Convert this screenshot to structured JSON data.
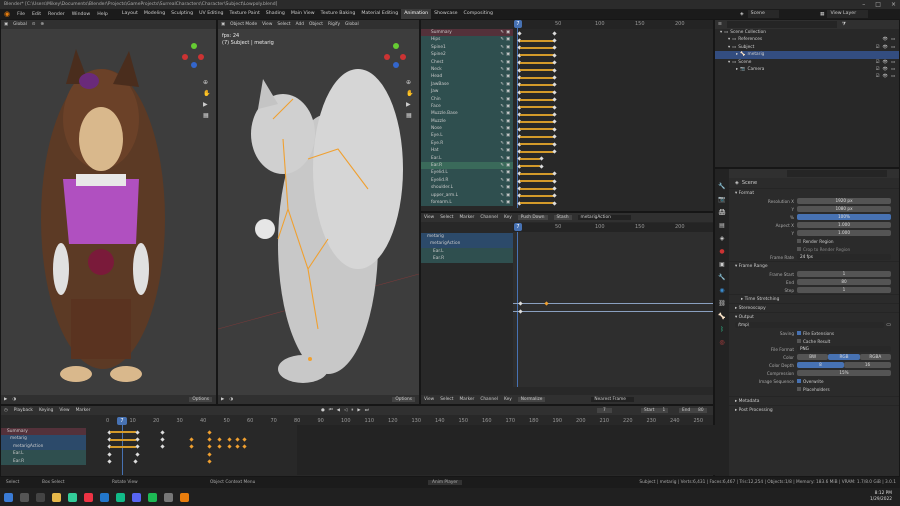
{
  "title": "Blender* [C:\\Users\\Mikey\\Documents\\Blender\\Projects\\GameProjects\\SurrealCharacters\\Character\\Subject\\Lowpoly.blend]",
  "menu": [
    "File",
    "Edit",
    "Render",
    "Window",
    "Help"
  ],
  "workspaces": [
    "Layout",
    "Modeling",
    "Sculpting",
    "UV Editing",
    "Texture Paint",
    "Shading",
    "Main View",
    "Texture Baking",
    "Material Editing",
    "Animation",
    "Showcase",
    "Compositing"
  ],
  "active_workspace": "Animation",
  "scene": "Scene",
  "view_layer": "View Layer",
  "vp1": {
    "orient": "Global",
    "options": "Options"
  },
  "vp2": {
    "mode": "Object Mode",
    "menus": [
      "View",
      "Select",
      "Add",
      "Object",
      "Rigify"
    ],
    "orient": "Global",
    "fps": "fps: 24",
    "subject": "(7) Subject | metarig",
    "options": "Options"
  },
  "dopesheet": {
    "ticks": [
      "0",
      "50",
      "100",
      "150",
      "200",
      "250"
    ],
    "current": "7",
    "channels": [
      "Summary",
      "Hips",
      "Spine1",
      "Spine2",
      "Chest",
      "Neck",
      "Head",
      "JawBase",
      "Jaw",
      "Chin",
      "Face",
      "Muzzle.Base",
      "Muzzle",
      "Nose",
      "Eye.L",
      "Eye.R",
      "Hat",
      "Ear.L",
      "Ear.R",
      "Eyelid.L",
      "Eyelid.R",
      "shoulder.L",
      "upper_arm.L",
      "forearm.L"
    ],
    "menus": [
      "View",
      "Select",
      "Marker",
      "Channel",
      "Key"
    ],
    "push": "Push Down",
    "stash": "Stash",
    "action": "metarigAction"
  },
  "graph": {
    "channels": [
      "metarig",
      "metarigAction",
      "Ear.L",
      "Ear.R"
    ],
    "ticks": [
      "0",
      "50",
      "100",
      "150",
      "200"
    ],
    "current": "7",
    "menus": [
      "View",
      "Select",
      "Marker",
      "Channel",
      "Key"
    ],
    "normalize": "Normalize",
    "frame_mode": "Nearest Frame"
  },
  "timeline": {
    "menus": [
      "Playback",
      "Keying",
      "View",
      "Marker"
    ],
    "current": "7",
    "start_label": "Start",
    "start": "1",
    "end_label": "End",
    "end": "80",
    "ticks": [
      "0",
      "10",
      "20",
      "30",
      "40",
      "50",
      "60",
      "70",
      "80",
      "90",
      "100",
      "110",
      "120",
      "130",
      "140",
      "150",
      "160",
      "170",
      "180",
      "190",
      "200",
      "210",
      "220",
      "230",
      "240",
      "250"
    ],
    "channels": [
      "Summary",
      "metarig",
      "metarigAction",
      "Ear.L",
      "Ear.R"
    ]
  },
  "outliner": {
    "search": "",
    "items": [
      {
        "label": "Scene Collection",
        "d": 0
      },
      {
        "label": "References",
        "d": 1
      },
      {
        "label": "Subject",
        "d": 1
      },
      {
        "label": "metarig",
        "d": 2,
        "sel": true
      },
      {
        "label": "Scene",
        "d": 1
      },
      {
        "label": "Camera",
        "d": 2
      }
    ]
  },
  "props": {
    "scene": "Scene",
    "sections": {
      "format": "Format",
      "frame_range": "Frame Range",
      "time_stretch": "Time Stretching",
      "stereo": "Stereoscopy",
      "output": "Output",
      "metadata": "Metadata",
      "post": "Post Processing"
    },
    "resx": {
      "l": "Resolution X",
      "v": "1920 px"
    },
    "resy": {
      "l": "Y",
      "v": "1080 px"
    },
    "pct": {
      "l": "%",
      "v": "100%"
    },
    "aspx": {
      "l": "Aspect X",
      "v": "1.000"
    },
    "aspy": {
      "l": "Y",
      "v": "1.000"
    },
    "render_region": "Render Region",
    "crop": "Crop to Render Region",
    "frame_rate": {
      "l": "Frame Rate",
      "v": "24 fps"
    },
    "fstart": {
      "l": "Frame Start",
      "v": "1"
    },
    "fend": {
      "l": "End",
      "v": "80"
    },
    "fstep": {
      "l": "Step",
      "v": "1"
    },
    "path": "/tmp\\",
    "saving": "Saving",
    "file_ext": "File Extensions",
    "cache": "Cache Result",
    "file_format": {
      "l": "File Format",
      "v": "PNG"
    },
    "color": {
      "l": "Color",
      "opts": [
        "BW",
        "RGB",
        "RGBA"
      ]
    },
    "depth": {
      "l": "Color Depth",
      "opts": [
        "8",
        "16"
      ]
    },
    "compression": {
      "l": "Compression",
      "v": "15%"
    },
    "img_seq": "Image Sequence",
    "overwrite": "Overwrite",
    "placeholders": "Placeholders"
  },
  "status": {
    "select": "Select",
    "box": "Box Select",
    "rotate": "Rotate View",
    "ctx": "Object Context Menu",
    "anim": "Anim Player",
    "info": "Subject | metarig | Verts:6,431 | Faces:6,467 | Tris:12,254 | Objects:1/8 | Memory: 183.6 MiB | VRAM: 1.7/8.0 GiB | 3.0.1"
  },
  "clock": {
    "time": "8:12 PM",
    "date": "1/29/2022"
  },
  "colors": {
    "accent": "#4772b3",
    "key_orange": "#f0a030",
    "summary": "#54313a",
    "channel": "#2f4f4f"
  }
}
